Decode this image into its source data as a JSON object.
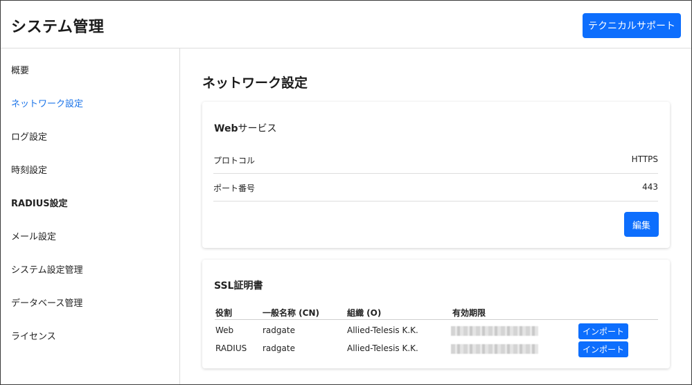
{
  "header": {
    "title": "システム管理",
    "support_label": "テクニカルサポート"
  },
  "sidebar": {
    "items": [
      {
        "label": "概要",
        "active": false
      },
      {
        "label": "ネットワーク設定",
        "active": true
      },
      {
        "label": "ログ設定",
        "active": false
      },
      {
        "label": "時刻設定",
        "active": false
      },
      {
        "label": "RADIUS設定",
        "active": false
      },
      {
        "label": "メール設定",
        "active": false
      },
      {
        "label": "システム設定管理",
        "active": false
      },
      {
        "label": "データベース管理",
        "active": false
      },
      {
        "label": "ライセンス",
        "active": false
      }
    ]
  },
  "main": {
    "page_title": "ネットワーク設定",
    "web_service": {
      "title_prefix": "Web",
      "title_suffix": "サービス",
      "rows": [
        {
          "key": "プロトコル",
          "value": "HTTPS"
        },
        {
          "key": "ポート番号",
          "value": "443"
        }
      ],
      "edit_label": "編集"
    },
    "ssl": {
      "title": "SSL証明書",
      "columns": [
        "役割",
        "一般名称 (CN)",
        "組織 (O)",
        "有効期限"
      ],
      "rows": [
        {
          "role": "Web",
          "cn": "radgate",
          "org": "Allied-Telesis K.K.",
          "expiry": "",
          "action": "インポート"
        },
        {
          "role": "RADIUS",
          "cn": "radgate",
          "org": "Allied-Telesis K.K.",
          "expiry": "",
          "action": "インポート"
        }
      ]
    }
  },
  "colors": {
    "accent": "#0d6efd",
    "active_link": "#1a73e8"
  }
}
